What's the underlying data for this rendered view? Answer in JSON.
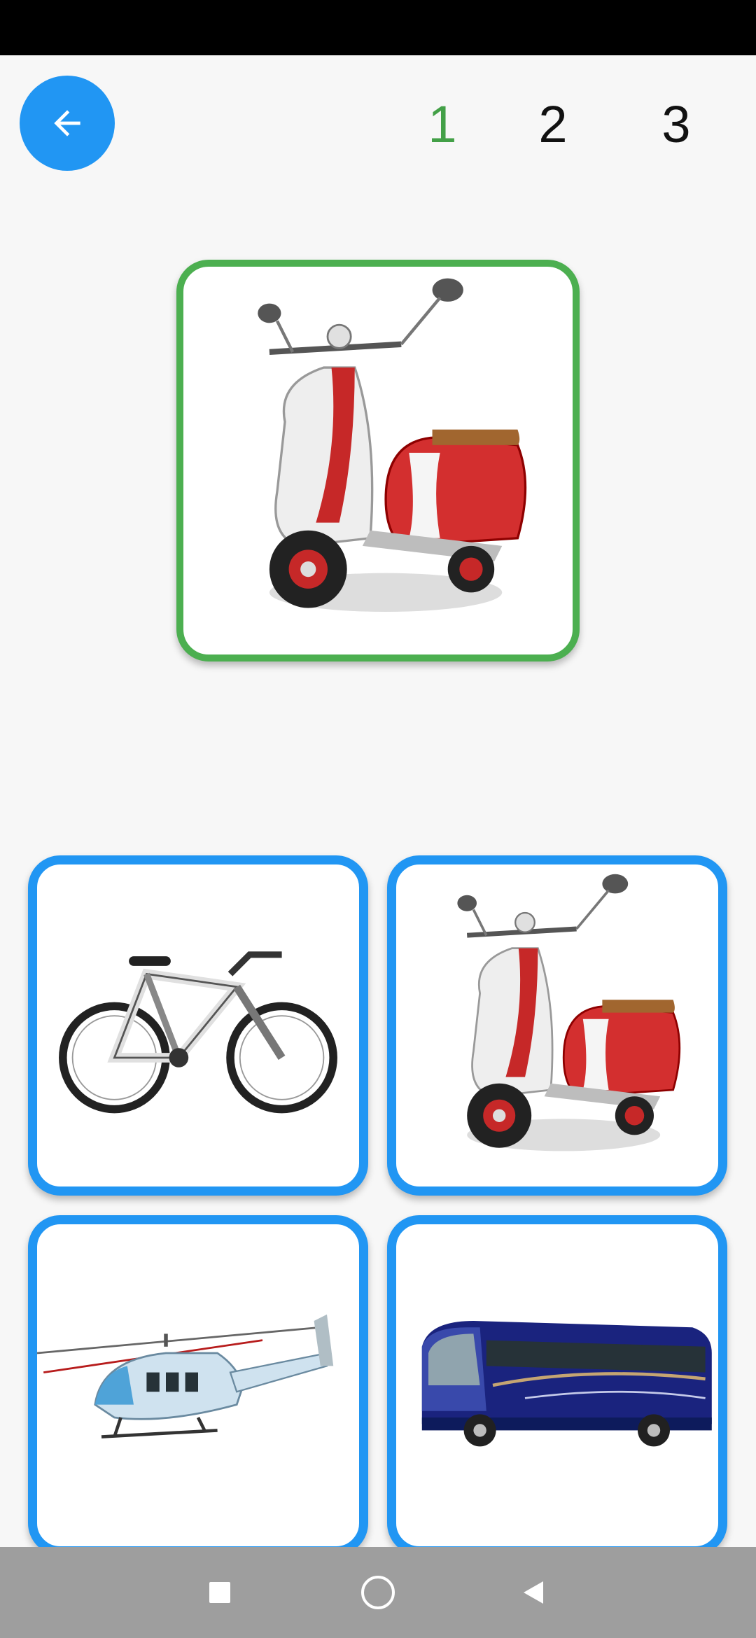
{
  "header": {
    "back_icon": "arrow-left-icon",
    "steps": [
      "1",
      "2",
      "3"
    ],
    "active_step_color": "#43a047",
    "inactive_step_color": "#111111"
  },
  "colors": {
    "accent": "#2196f3",
    "correct": "#4caf50"
  },
  "target": {
    "image": "scooter"
  },
  "options": [
    {
      "image": "bicycle"
    },
    {
      "image": "scooter"
    },
    {
      "image": "helicopter"
    },
    {
      "image": "bus"
    }
  ],
  "navigation": {
    "icons": [
      "square-recents-icon",
      "circle-home-icon",
      "triangle-back-icon"
    ]
  }
}
